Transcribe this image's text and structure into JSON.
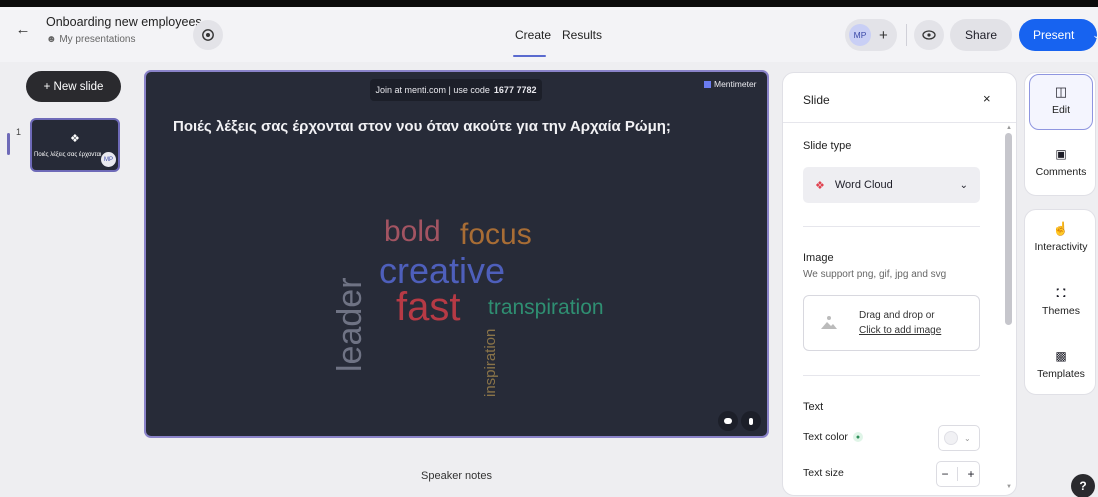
{
  "header": {
    "back_icon": "arrow-left-icon",
    "title": "Onboarding new employees",
    "subtitle": "My presentations",
    "tabs": [
      {
        "label": "Create",
        "active": true
      },
      {
        "label": "Results",
        "active": false
      }
    ],
    "avatar_initials": "MP",
    "share_label": "Share",
    "present_label": "Present",
    "accent": "#1763f0"
  },
  "sidebar": {
    "new_slide_label": "+ New slide",
    "slides": [
      {
        "number": "1",
        "title": "Ποιές λέξεις σας έρχονται",
        "badge": "MP"
      }
    ]
  },
  "slide": {
    "join_text": "Join at menti.com | use code",
    "join_code": "1677 7782",
    "brand": "Mentimeter",
    "question": "Ποιές λέξεις σας έρχονται στον νου όταν ακούτε για την Αρχαία Ρώμη;",
    "words": [
      {
        "text": "bold",
        "color": "#a35462"
      },
      {
        "text": "focus",
        "color": "#a86d35"
      },
      {
        "text": "creative",
        "color": "#4e5fbb"
      },
      {
        "text": "fast",
        "color": "#b73a45"
      },
      {
        "text": "transpiration",
        "color": "#2f8f72"
      },
      {
        "text": "leader",
        "color": "#6f7384"
      },
      {
        "text": "inspiration",
        "color": "#8a7449"
      }
    ]
  },
  "speaker_notes_label": "Speaker notes",
  "panel": {
    "title": "Slide",
    "slide_type_label": "Slide type",
    "slide_type_value": "Word Cloud",
    "image_label": "Image",
    "image_support": "We support png, gif, jpg and svg",
    "drop_text": "Drag and drop or",
    "drop_link": "Click to add image",
    "text_label": "Text",
    "text_color_label": "Text color",
    "text_size_label": "Text size",
    "minus": "−",
    "plus": "+"
  },
  "rightbar": {
    "items": [
      {
        "label": "Edit",
        "icon": "edit-panel-icon"
      },
      {
        "label": "Comments",
        "icon": "comment-icon"
      },
      {
        "label": "Interactivity",
        "icon": "interactivity-icon"
      },
      {
        "label": "Themes",
        "icon": "themes-icon"
      },
      {
        "label": "Templates",
        "icon": "templates-icon"
      }
    ],
    "help": "?"
  }
}
